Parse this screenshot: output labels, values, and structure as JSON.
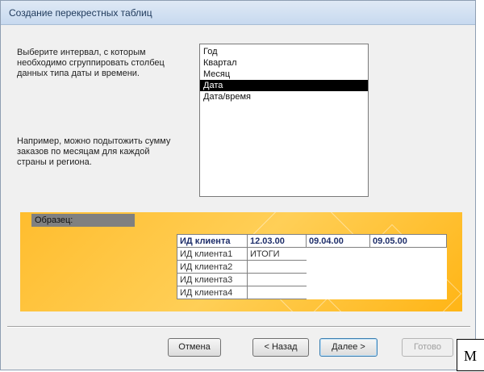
{
  "window": {
    "title": "Создание перекрестных таблиц"
  },
  "instructions": {
    "prompt": "Выберите интервал, с которым\nнеобходимо сгруппировать столбец\nданных типа даты и времени.",
    "example": "Например, можно подытожить сумму\nзаказов по месяцам для каждой\nстраны и региона."
  },
  "interval_list": {
    "items": [
      "Год",
      "Квартал",
      "Месяц",
      "Дата",
      "Дата/время"
    ],
    "selected": "Дата"
  },
  "sample": {
    "label": "Образец:",
    "headers": [
      "ИД клиента",
      "12.03.00",
      "09.04.00",
      "09.05.00"
    ],
    "rows": [
      [
        "ИД клиента1",
        "ИТОГИ"
      ],
      [
        "ИД клиента2",
        ""
      ],
      [
        "ИД клиента3",
        ""
      ],
      [
        "ИД клиента4",
        ""
      ]
    ]
  },
  "buttons": {
    "cancel": "Отмена",
    "back": "< Назад",
    "next": "Далее >",
    "finish": "Готово"
  },
  "clipped_text": "М"
}
